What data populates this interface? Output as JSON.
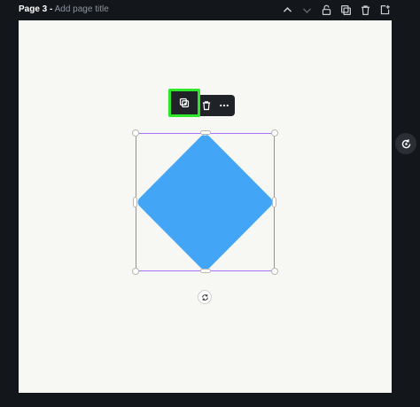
{
  "header": {
    "page_label": "Page 3 -",
    "title_placeholder": "Add page title",
    "icons": [
      "chevron-up-icon",
      "chevron-down-icon",
      "unlock-icon",
      "duplicate-page-icon",
      "trash-icon",
      "add-page-icon"
    ]
  },
  "toolbar": {
    "duplicate_icon": "duplicate-icon",
    "delete_icon": "trash-icon",
    "more_icon": "more-horizontal-icon"
  },
  "shape": {
    "color": "#42a5f5",
    "selection_color": "#a970ff"
  },
  "colors": {
    "highlight": "#2ee62a"
  }
}
